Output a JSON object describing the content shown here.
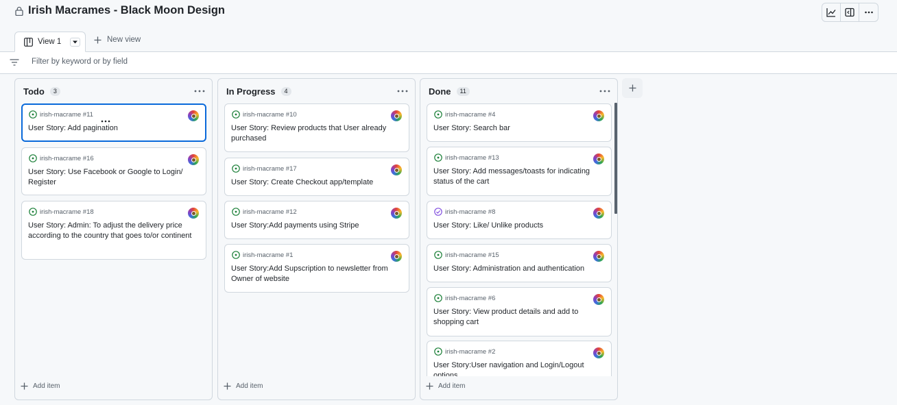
{
  "project": {
    "title": "Irish Macrames - Black Moon Design"
  },
  "tabs": {
    "active_label": "View 1",
    "new_view_label": "New view"
  },
  "filter": {
    "placeholder": "Filter by keyword or by field"
  },
  "add_item_label": "Add item",
  "colors": {
    "accent": "#0969da",
    "open_issue": "#1a7f37",
    "closed_issue": "#8250df",
    "border": "#d0d7de"
  },
  "columns": [
    {
      "name": "Todo",
      "count": "3",
      "cards": [
        {
          "ref": "irish-macrame #11",
          "title": "User Story: Add pagination",
          "status": "open",
          "selected": true
        },
        {
          "ref": "irish-macrame #16",
          "title": "User Story: Use Facebook or Google to Login/ Register",
          "status": "open"
        },
        {
          "ref": "irish-macrame #18",
          "title": "User Story: Admin: To adjust the delivery price according to the country that goes to/or continent",
          "status": "open"
        }
      ]
    },
    {
      "name": "In Progress",
      "count": "4",
      "cards": [
        {
          "ref": "irish-macrame #10",
          "title": "User Story: Review products that User already purchased",
          "status": "open"
        },
        {
          "ref": "irish-macrame #17",
          "title": "User Story: Create Checkout app/template",
          "status": "open"
        },
        {
          "ref": "irish-macrame #12",
          "title": "User Story:Add payments using Stripe",
          "status": "open"
        },
        {
          "ref": "irish-macrame #1",
          "title": "User Story:Add Supscription to newsletter from Owner of website",
          "status": "open"
        }
      ]
    },
    {
      "name": "Done",
      "count": "11",
      "cards": [
        {
          "ref": "irish-macrame #4",
          "title": "User Story: Search bar",
          "status": "open"
        },
        {
          "ref": "irish-macrame #13",
          "title": "User Story: Add messages/toasts for indicating status of the cart",
          "status": "open"
        },
        {
          "ref": "irish-macrame #8",
          "title": "User Story: Like/ Unlike products",
          "status": "closed"
        },
        {
          "ref": "irish-macrame #15",
          "title": "User Story: Administration and authentication",
          "status": "open"
        },
        {
          "ref": "irish-macrame #6",
          "title": "User Story: View product details and add to shopping cart",
          "status": "open"
        },
        {
          "ref": "irish-macrame #2",
          "title": "User Story:User navigation and Login/Logout options",
          "status": "open"
        }
      ]
    }
  ]
}
